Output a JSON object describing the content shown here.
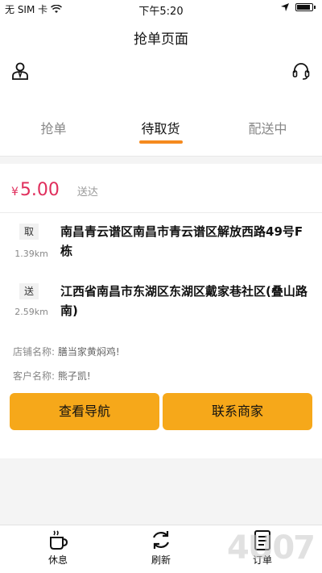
{
  "status_bar": {
    "carrier": "无 SIM 卡",
    "time": "下午5:20"
  },
  "nav": {
    "title": "抢单页面"
  },
  "icons": {
    "left": "user-icon",
    "right": "headset-icon"
  },
  "tabs": [
    {
      "label": "抢单",
      "active": false
    },
    {
      "label": "待取货",
      "active": true
    },
    {
      "label": "配送中",
      "active": false
    }
  ],
  "accent_color": "#f58a1f",
  "button_color": "#f6a81a",
  "price_color": "#e02e5c",
  "order": {
    "price_symbol": "¥",
    "price": "5.00",
    "price_note": "送达",
    "pickup": {
      "tag": "取",
      "distance": "1.39km",
      "address": "南昌青云谱区南昌市青云谱区解放西路49号F栋"
    },
    "delivery": {
      "tag": "送",
      "distance": "2.59km",
      "address": "江西省南昌市东湖区东湖区戴家巷社区(叠山路南)"
    },
    "store_label": "店铺名称:",
    "store_value": "膳当家黄焖鸡!",
    "customer_label": "客户名称:",
    "customer_value": "熊子凯!",
    "nav_button": "查看导航",
    "contact_button": "联系商家"
  },
  "bottom_nav": [
    {
      "label": "休息",
      "icon": "coffee-cup-icon"
    },
    {
      "label": "刷新",
      "icon": "refresh-icon"
    },
    {
      "label": "订单",
      "icon": "order-list-icon"
    }
  ],
  "watermark": "4U07"
}
